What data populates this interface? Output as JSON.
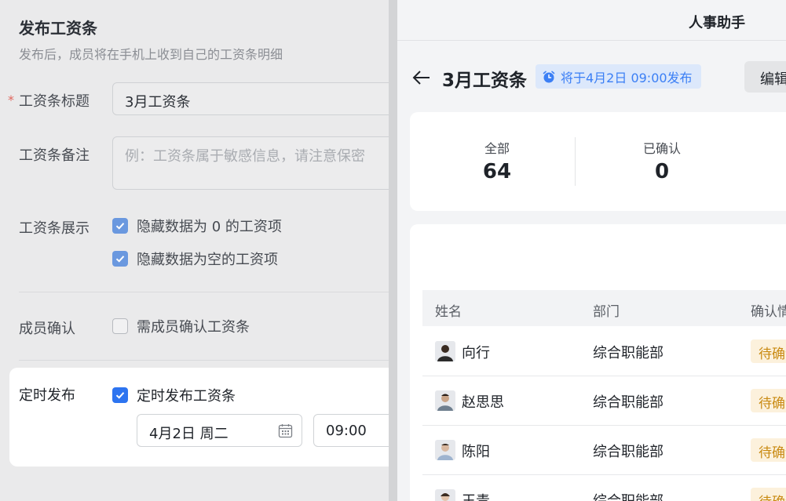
{
  "form": {
    "title": "发布工资条",
    "subtitle": "发布后，成员将在手机上收到自己的工资条明细",
    "required_mark": "*",
    "slip_title_label": "工资条标题",
    "slip_title_value": "3月工资条",
    "remark_label": "工资条备注",
    "remark_placeholder": "例：工资条属于敏感信息，请注意保密",
    "display_label": "工资条展示",
    "hide_zero_label": "隐藏数据为 0 的工资项",
    "hide_empty_label": "隐藏数据为空的工资项",
    "confirm_label": "成员确认",
    "confirm_option_label": "需成员确认工资条",
    "schedule_label": "定时发布",
    "schedule_option_label": "定时发布工资条",
    "date_value": "4月2日 周二",
    "time_value": "09:00"
  },
  "preview": {
    "app_title": "人事助手",
    "page_title": "3月工资条",
    "schedule_badge": "将于4月2日 09:00发布",
    "edit_label": "编辑",
    "stats": [
      {
        "label": "全部",
        "value": "64"
      },
      {
        "label": "已确认",
        "value": "0"
      }
    ],
    "table": {
      "headers": [
        "姓名",
        "部门",
        "确认情况"
      ],
      "rows": [
        {
          "name": "向行",
          "dept": "综合职能部",
          "status": "待确认"
        },
        {
          "name": "赵思思",
          "dept": "综合职能部",
          "status": "待确认"
        },
        {
          "name": "陈阳",
          "dept": "综合职能部",
          "status": "待确认"
        },
        {
          "name": "王青",
          "dept": "综合职能部",
          "status": "待确认"
        }
      ]
    }
  },
  "colors": {
    "accent": "#2d74f0",
    "badge_bg": "#dce8fb",
    "pending_bg": "#fcf1dc",
    "pending_text": "#c98a12"
  }
}
